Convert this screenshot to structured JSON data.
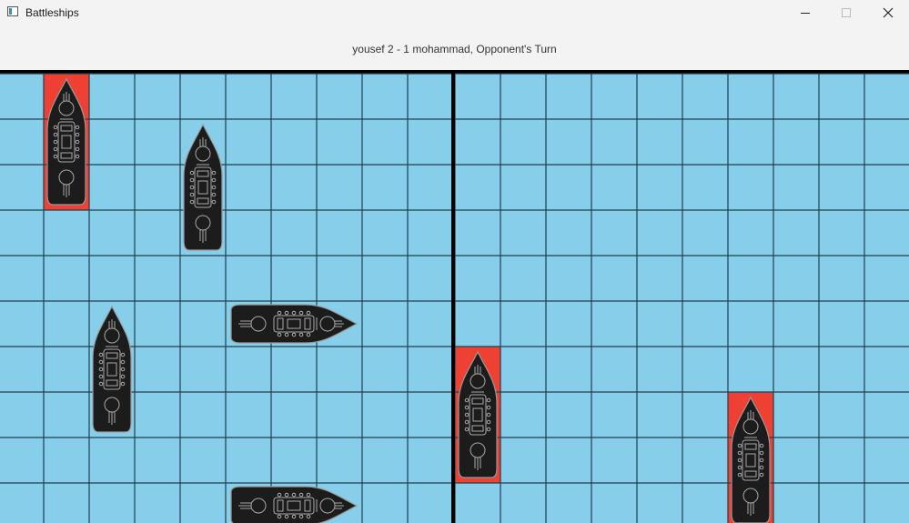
{
  "window": {
    "title": "Battleships",
    "app_icon": "window-app-icon"
  },
  "controls": {
    "minimize": "minimize-icon",
    "maximize": "maximize-icon",
    "close": "close-icon"
  },
  "status_text": "yousef 2 - 1 mohammad, Opponent's Turn",
  "colors": {
    "water": "#87ceeb",
    "hit": "#ee4133",
    "grid": "#1f3f4c",
    "divider": "#000000",
    "ship": "#1c1c1c"
  },
  "boards": [
    {
      "name": "player-board",
      "ships": [
        {
          "col": 1,
          "row": 0,
          "length": 3,
          "orientation": "vertical",
          "hit": true
        },
        {
          "col": 4,
          "row": 1,
          "length": 3,
          "orientation": "vertical",
          "hit": false
        },
        {
          "col": 2,
          "row": 5,
          "length": 3,
          "orientation": "vertical",
          "hit": false
        },
        {
          "col": 5,
          "row": 5,
          "length": 3,
          "orientation": "horizontal",
          "hit": false
        },
        {
          "col": 5,
          "row": 9,
          "length": 3,
          "orientation": "horizontal",
          "hit": false
        }
      ]
    },
    {
      "name": "opponent-board",
      "ships": [
        {
          "col": 0,
          "row": 6,
          "length": 3,
          "orientation": "vertical",
          "hit": true
        },
        {
          "col": 6,
          "row": 7,
          "length": 3,
          "orientation": "vertical",
          "hit": true
        }
      ]
    }
  ]
}
